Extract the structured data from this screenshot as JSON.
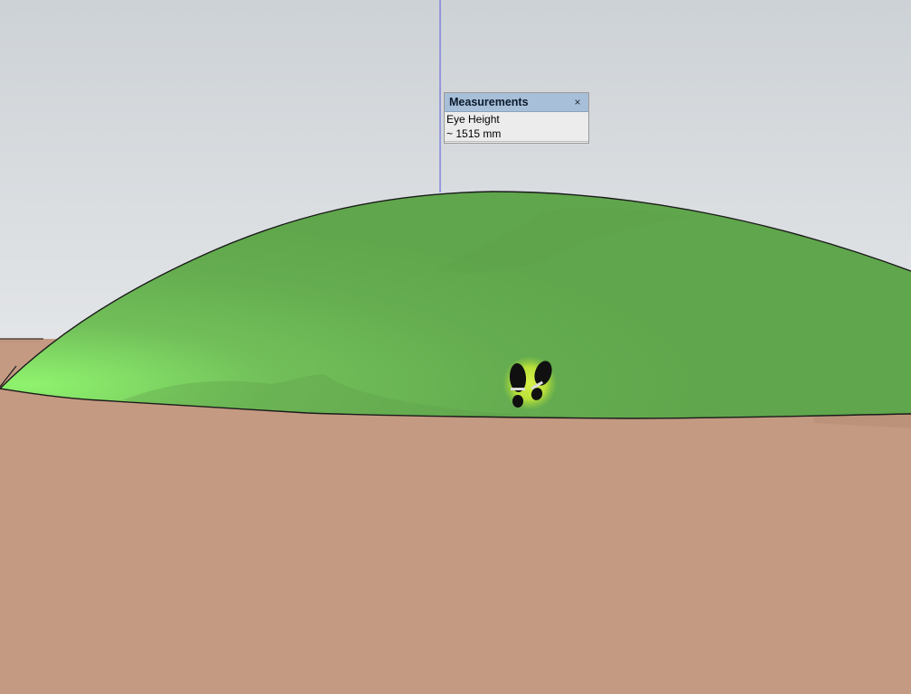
{
  "measurements": {
    "title": "Measurements",
    "close_glyph": "×",
    "label": "Eye Height",
    "value": "~ 1515 mm"
  },
  "scene": {
    "sky_color_top": "#cfd4d8",
    "sky_color_bottom": "#e4e7e9",
    "ground_color": "#c49a82",
    "hill_color": "#63a84f",
    "hill_highlight_color": "#8ff46d",
    "edge_color": "#1a1a1a",
    "blue_axis_color": "#5a5ad8",
    "cursor_icon": "position-camera-feet-icon"
  }
}
